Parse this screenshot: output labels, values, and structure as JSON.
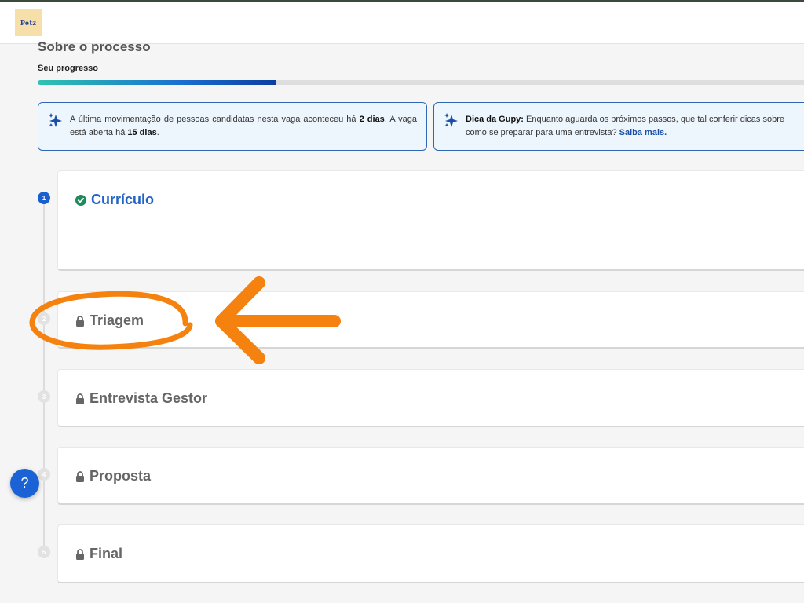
{
  "header": {
    "logo_text": "Petz"
  },
  "page": {
    "title": "Sobre o processo",
    "progress_label": "Seu progresso",
    "progress_value": 0.31
  },
  "info_boxes": [
    {
      "icon": "sparkle-icon",
      "text_1": "A última movimentação de pessoas candidatas nesta vaga aconteceu há ",
      "bold_1": "2 dias",
      "text_2": ". A vaga está aberta há ",
      "bold_2": "15 dias",
      "text_3": "."
    },
    {
      "icon": "sparkle-icon",
      "bold_1": "Dica da Gupy:",
      "text_1": " Enquanto aguarda os próximos passos, que tal conferir dicas sobre como se preparar para uma entrevista? ",
      "link": "Saiba mais."
    }
  ],
  "steps": [
    {
      "number": "1",
      "title": "Currículo",
      "status": "done"
    },
    {
      "number": "2",
      "title": "Triagem",
      "status": "locked"
    },
    {
      "number": "3",
      "title": "Entrevista Gestor",
      "status": "locked"
    },
    {
      "number": "4",
      "title": "Proposta",
      "status": "locked"
    },
    {
      "number": "5",
      "title": "Final",
      "status": "locked"
    }
  ],
  "help": {
    "label": "?"
  },
  "colors": {
    "accent": "#1a5fd0",
    "done_check": "#1f8a5b",
    "annotation": "#f5820f",
    "info_border": "#2f67b4"
  }
}
